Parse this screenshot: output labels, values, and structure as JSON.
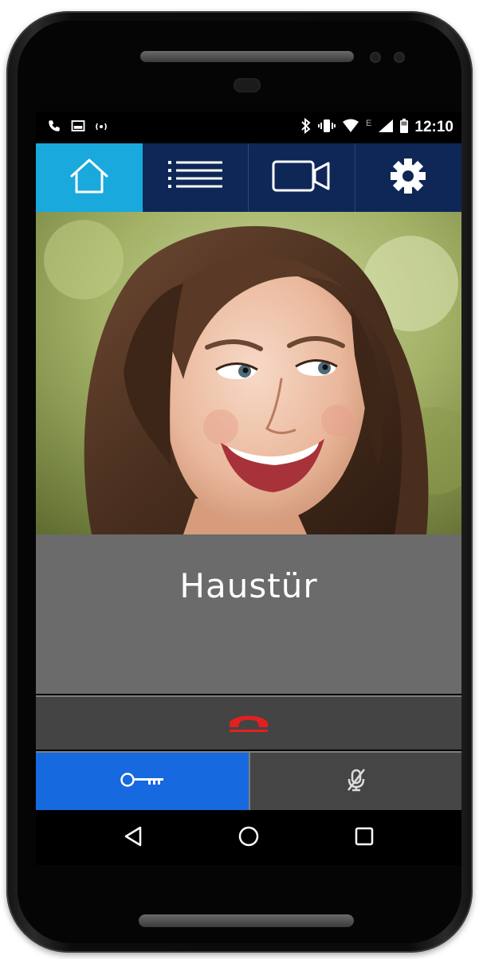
{
  "statusbar": {
    "time": "12:10",
    "network_label": "E",
    "left_icons": [
      "phone-call-icon",
      "image-notification-icon",
      "cast-icon"
    ],
    "right_icons": [
      "bluetooth-icon",
      "vibrate-icon",
      "wifi-icon",
      "signal-icon",
      "battery-icon"
    ]
  },
  "tabs": [
    {
      "icon": "home-icon",
      "active": true
    },
    {
      "icon": "list-icon",
      "active": false
    },
    {
      "icon": "video-camera-icon",
      "active": false
    },
    {
      "icon": "gear-icon",
      "active": false
    }
  ],
  "caller": {
    "name": "Haustür"
  },
  "actions": {
    "hangup_icon": "hang-up-icon",
    "door_open_icon": "key-icon",
    "mute_icon": "microphone-muted-icon"
  },
  "navbar": {
    "icons": [
      "back-icon",
      "home-circle-icon",
      "recents-icon"
    ]
  },
  "colors": {
    "tab_bar": "#0e2756",
    "tab_active": "#19a9dc",
    "caller_panel": "#6b6b6b",
    "hangup_row": "#444444",
    "key_button": "#1769e0",
    "mute_button": "#454545",
    "hangup_icon": "#e32020"
  }
}
